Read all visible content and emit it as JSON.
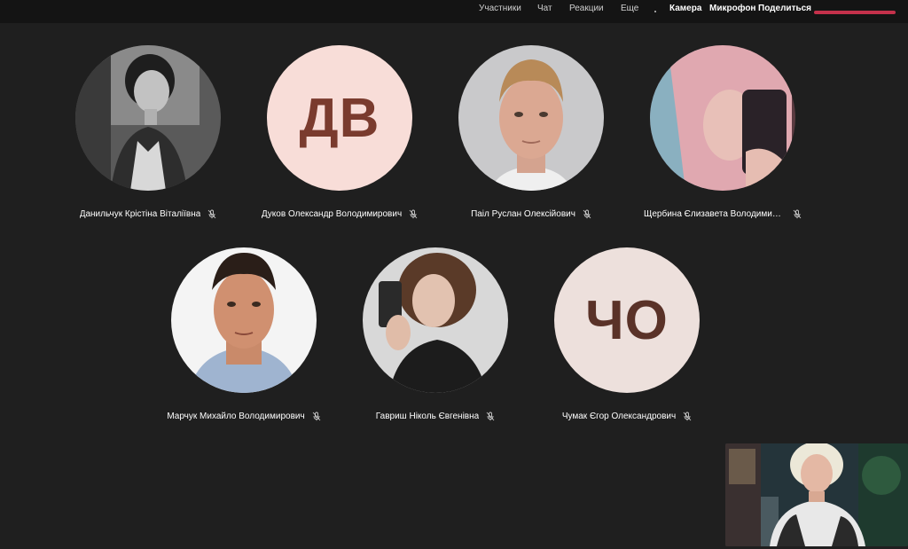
{
  "toolbar": {
    "participants_label": "Участники",
    "chat_label": "Чат",
    "reactions_label": "Реакции",
    "more_label": "Еще",
    "camera_label": "Камера",
    "microphone_label": "Микрофон",
    "share_label": "Поделиться",
    "leave_color": "#c4314b"
  },
  "participants": [
    {
      "name": "Данильчук Крістіна Віталіївна",
      "avatar_type": "photo",
      "initials": "",
      "mic": "off"
    },
    {
      "name": "Дуков Олександр Володимирович",
      "avatar_type": "initials",
      "initials": "ДВ",
      "bg": "#f8ddd8",
      "mic": "off"
    },
    {
      "name": "Паіл Руслан Олексійович",
      "avatar_type": "photo",
      "initials": "",
      "mic": "off"
    },
    {
      "name": "Щербина Єлизавета Володимирівна",
      "avatar_type": "photo",
      "initials": "",
      "mic": "off"
    },
    {
      "name": "Марчук Михайло Володимирович",
      "avatar_type": "photo",
      "initials": "",
      "mic": "off"
    },
    {
      "name": "Гавриш Ніколь Євгенівна",
      "avatar_type": "photo",
      "initials": "",
      "mic": "off"
    },
    {
      "name": "Чумак Єгор Олександрович",
      "avatar_type": "initials",
      "initials": "ЧО",
      "bg": "#ede0dc",
      "mic": "off"
    }
  ],
  "self_view": {
    "icon": "video-self-view"
  }
}
